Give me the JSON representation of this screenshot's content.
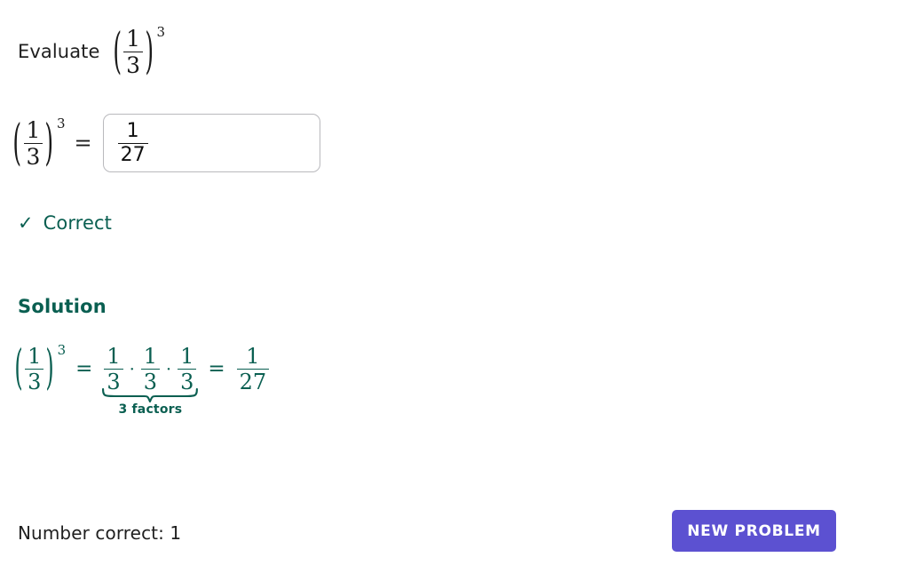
{
  "page": {
    "background_color": "#ffffff",
    "accent_color": "#5c51d1",
    "correct_color": "#0a5f51",
    "text_color": "#1f1f1f"
  },
  "prompt": {
    "label": "Evaluate",
    "expression": {
      "base_numerator": "1",
      "base_denominator": "3",
      "exponent": "3",
      "left_paren": "(",
      "right_paren": ")"
    }
  },
  "answer": {
    "expression": {
      "base_numerator": "1",
      "base_denominator": "3",
      "exponent": "3",
      "left_paren": "(",
      "right_paren": ")"
    },
    "equals": "=",
    "input_value": {
      "numerator": "1",
      "denominator": "27"
    }
  },
  "feedback": {
    "icon": "check-icon",
    "icon_glyph": "✓",
    "label": "Correct"
  },
  "solution": {
    "heading": "Solution",
    "expression": {
      "left_paren": "(",
      "right_paren": ")",
      "base_numerator": "1",
      "base_denominator": "3",
      "exponent": "3",
      "equals_1": "=",
      "factors": [
        {
          "numerator": "1",
          "denominator": "3"
        },
        {
          "numerator": "1",
          "denominator": "3"
        },
        {
          "numerator": "1",
          "denominator": "3"
        }
      ],
      "multiply_symbol": "·",
      "equals_2": "=",
      "result_numerator": "1",
      "result_denominator": "27"
    },
    "brace_label": "3 factors"
  },
  "footer": {
    "score_label": "Number correct: 1",
    "new_problem_label": "NEW PROBLEM"
  }
}
